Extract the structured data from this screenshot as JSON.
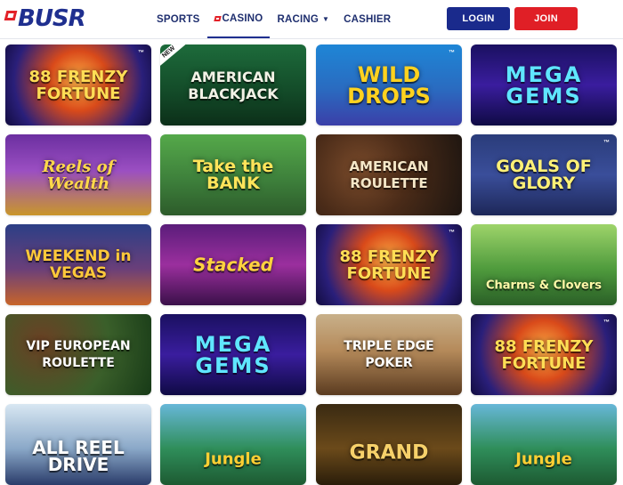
{
  "header": {
    "logo": "BUSR",
    "nav": [
      {
        "label": "SPORTS"
      },
      {
        "label": "CASINO"
      },
      {
        "label": "RACING"
      },
      {
        "label": "CASHIER"
      }
    ],
    "login_label": "LOGIN",
    "join_label": "JOIN"
  },
  "colors": {
    "brand_blue": "#1a2a8c",
    "brand_red": "#e01f26"
  },
  "games": [
    {
      "title": "88 FRENZY FORTUNE"
    },
    {
      "title": "AMERICAN BLACKJACK",
      "badge": "NEW"
    },
    {
      "title": "WILD DROPS"
    },
    {
      "title": "MEGA GEMS"
    },
    {
      "title": "Reels of Wealth"
    },
    {
      "title": "Take the BANK"
    },
    {
      "title": "AMERICAN ROULETTE"
    },
    {
      "title": "GOALS OF GLORY"
    },
    {
      "title": "WEEKEND in VEGAS"
    },
    {
      "title": "Stacked"
    },
    {
      "title": "88 FRENZY FORTUNE"
    },
    {
      "title": "Charms & Clovers"
    },
    {
      "title": "VIP EUROPEAN ROULETTE"
    },
    {
      "title": "MEGA GEMS"
    },
    {
      "title": "TRIPLE EDGE POKER"
    },
    {
      "title": "88 FRENZY FORTUNE"
    },
    {
      "title": "ALL REEL DRIVE"
    },
    {
      "title": "Jungle"
    },
    {
      "title": "GRAND"
    },
    {
      "title": "Jungle"
    }
  ]
}
